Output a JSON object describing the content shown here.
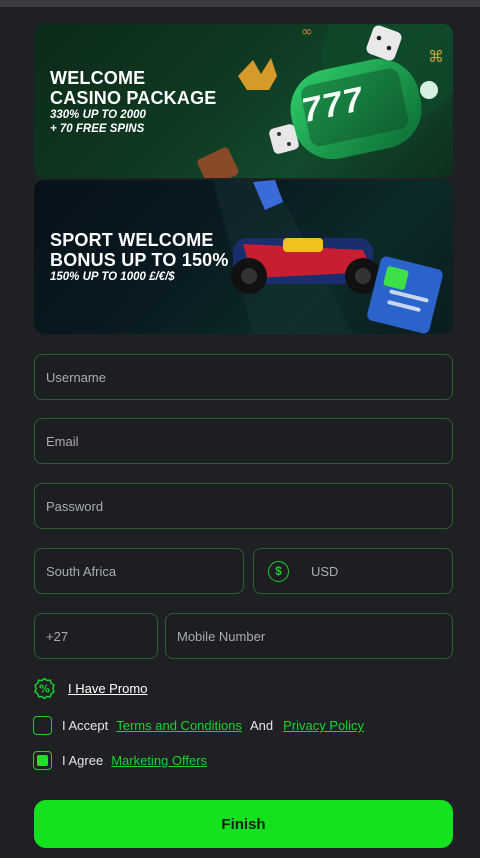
{
  "banners": {
    "casino": {
      "title_line1": "WELCOME",
      "title_line2": "CASINO PACKAGE",
      "sub_line1": "330% UP TO 2000",
      "sub_line2": "+ 70 FREE SPINS",
      "slot_digits": "777"
    },
    "sport": {
      "title_line1": "SPORT WELCOME",
      "title_line2": "BONUS UP TO 150%",
      "sub_line1": "150% UP TO 1000 £/€/$"
    }
  },
  "form": {
    "username_placeholder": "Username",
    "email_placeholder": "Email",
    "password_placeholder": "Password",
    "country_value": "South Africa",
    "currency_value": "USD",
    "currency_icon": "dollar-circle-icon",
    "phone_code": "+27",
    "mobile_placeholder": "Mobile Number",
    "promo_label": "I Have Promo",
    "promo_icon": "percent-badge-icon",
    "terms": {
      "prefix": "I Accept",
      "terms_link": "Terms and Conditions",
      "and": "And",
      "privacy_link": "Privacy Policy",
      "checked": false
    },
    "marketing": {
      "prefix": "I Agree",
      "link": "Marketing Offers",
      "checked": true
    },
    "finish_label": "Finish"
  },
  "colors": {
    "accent": "#14e21e",
    "field_border": "#2f5d33",
    "background": "#1e2024"
  }
}
